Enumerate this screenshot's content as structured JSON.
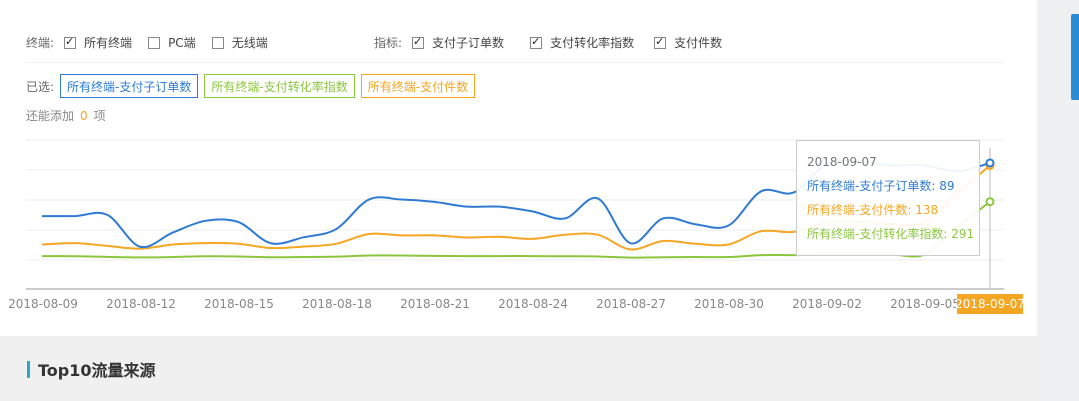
{
  "filters": {
    "terminal_label": "终端:",
    "terminal_options": [
      {
        "label": "所有终端",
        "checked": true
      },
      {
        "label": "PC端",
        "checked": false
      },
      {
        "label": "无线端",
        "checked": false
      }
    ],
    "metric_label": "指标:",
    "metric_options": [
      {
        "label": "支付子订单数",
        "checked": true
      },
      {
        "label": "支付转化率指数",
        "checked": true
      },
      {
        "label": "支付件数",
        "checked": true
      }
    ]
  },
  "selected": {
    "label": "已选:",
    "chips": [
      {
        "label": "所有终端-支付子订单数",
        "color": "#2f7bd3"
      },
      {
        "label": "所有终端-支付转化率指数",
        "color": "#8cc63f"
      },
      {
        "label": "所有终端-支付件数",
        "color": "#f5a623"
      }
    ],
    "add_prefix": "还能添加",
    "add_count": "0",
    "add_suffix": "项"
  },
  "chart_data": {
    "type": "line",
    "x_ticks": [
      "2018-08-09",
      "2018-08-12",
      "2018-08-15",
      "2018-08-18",
      "2018-08-21",
      "2018-08-24",
      "2018-08-27",
      "2018-08-30",
      "2018-09-02",
      "2018-09-05",
      "2018-09-07"
    ],
    "highlight_tick": "2018-09-07",
    "series": [
      {
        "name": "所有终端-支付子订单数",
        "color": "#2f7bd3",
        "values": [
          44,
          44,
          45,
          18,
          30,
          40,
          39,
          21,
          26,
          33,
          58,
          58,
          56,
          52,
          52,
          48,
          42,
          59,
          21,
          42,
          37,
          36,
          65,
          64,
          88,
          90,
          87,
          87,
          82,
          89
        ]
      },
      {
        "name": "所有终端-支付件数",
        "color": "#f5a623",
        "values": [
          25,
          27,
          23,
          19,
          25,
          27,
          26,
          20,
          22,
          26,
          40,
          38,
          38,
          35,
          36,
          33,
          39,
          39,
          18,
          30,
          26,
          25,
          44,
          43,
          56,
          58,
          54,
          57,
          98,
          138
        ]
      },
      {
        "name": "所有终端-支付转化率指数",
        "color": "#8cc63f",
        "values": [
          10,
          9,
          6,
          3,
          5,
          9,
          8,
          4,
          5,
          7,
          13,
          13,
          11,
          10,
          10,
          10,
          9,
          8,
          2,
          4,
          5,
          5,
          15,
          15,
          19,
          19,
          18,
          18,
          160,
          291
        ]
      }
    ],
    "tooltip": {
      "date": "2018-09-07",
      "lines": [
        {
          "text": "所有终端-支付子订单数: 89",
          "color": "#2f7bd3"
        },
        {
          "text": "所有终端-支付件数: 138",
          "color": "#f5a623"
        },
        {
          "text": "所有终端-支付转化率指数: 291",
          "color": "#8cc63f"
        }
      ]
    }
  },
  "section": {
    "title": "Top10流量来源"
  }
}
